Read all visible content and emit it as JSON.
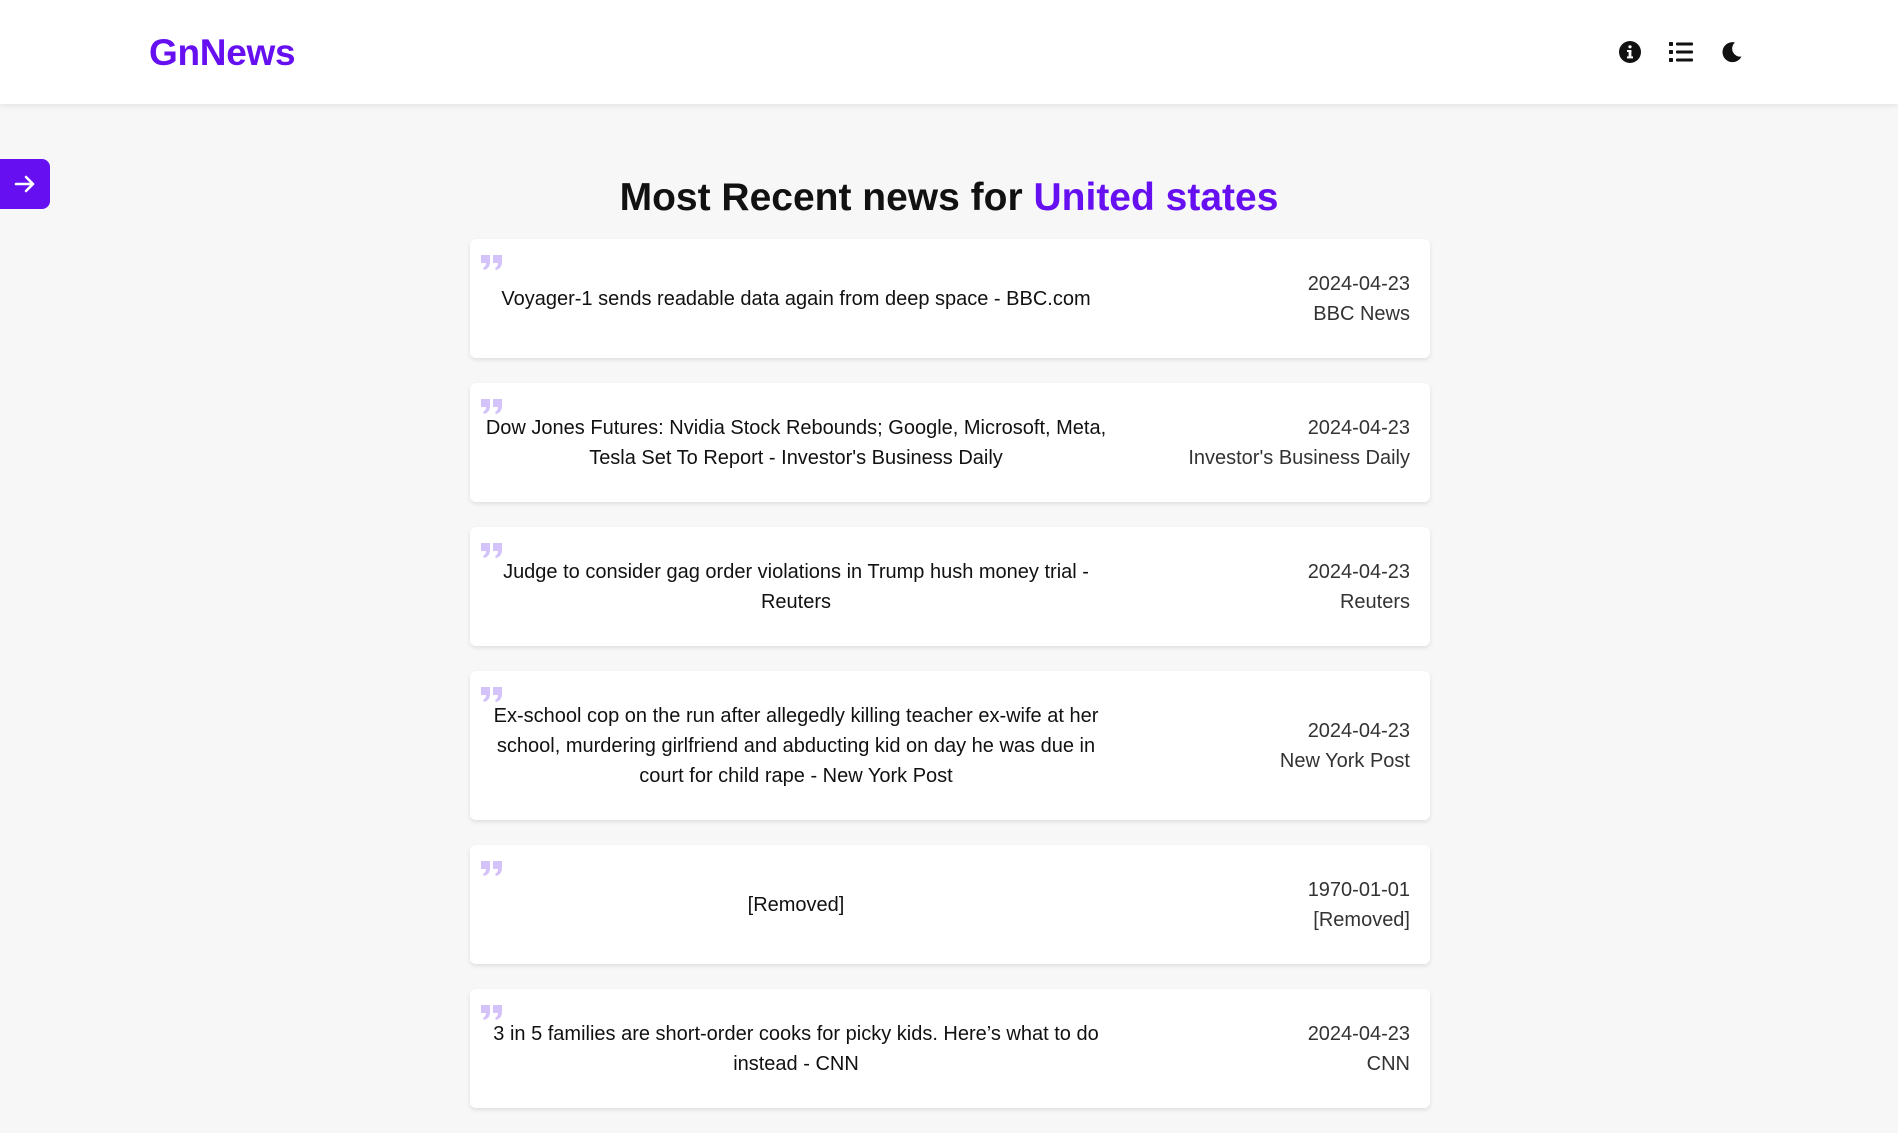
{
  "brand": "GnNews",
  "header_icons": [
    "info-icon",
    "list-icon",
    "moon-icon"
  ],
  "heading": {
    "prefix": "Most Recent news for ",
    "country": "United states"
  },
  "colors": {
    "accent": "#6610f2",
    "quote": "#d4c2fb"
  },
  "articles": [
    {
      "title": "Voyager-1 sends readable data again from deep space - BBC.com",
      "date": "2024-04-23",
      "source": "BBC News"
    },
    {
      "title": "Dow Jones Futures: Nvidia Stock Rebounds; Google, Microsoft, Meta, Tesla Set To Report - Investor's Business Daily",
      "date": "2024-04-23",
      "source": "Investor's Business Daily"
    },
    {
      "title": "Judge to consider gag order violations in Trump hush money trial - Reuters",
      "date": "2024-04-23",
      "source": "Reuters"
    },
    {
      "title": "Ex-school cop on the run after allegedly killing teacher ex-wife at her school, murdering girlfriend and abducting kid on day he was due in court for child rape - New York Post",
      "date": "2024-04-23",
      "source": "New York Post"
    },
    {
      "title": "[Removed]",
      "date": "1970-01-01",
      "source": "[Removed]"
    },
    {
      "title": "3 in 5 families are short-order cooks for picky kids. Here’s what to do instead - CNN",
      "date": "2024-04-23",
      "source": "CNN"
    }
  ]
}
